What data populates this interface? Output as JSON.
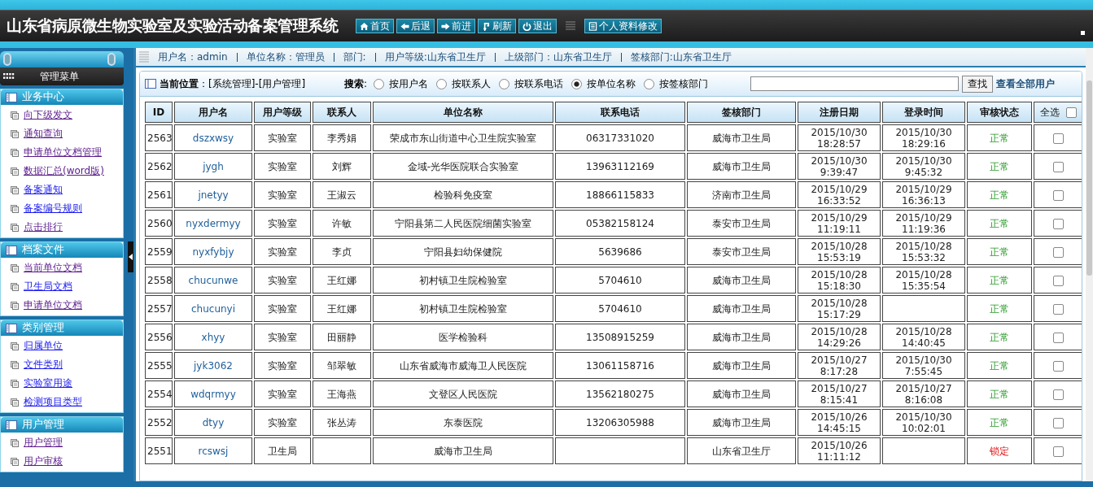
{
  "header": {
    "title": "山东省病原微生物实验室及实验活动备案管理系统",
    "nav_buttons": [
      "首页",
      "后退",
      "前进",
      "刷新",
      "退出"
    ],
    "profile_button": "个人资料修改"
  },
  "info_bar": [
    "用户名：admin",
    "单位名称：管理员",
    "部门:",
    "用户等级:山东省卫生厅",
    "上级部门：山东省卫生厅",
    "签核部门:山东省卫生厅"
  ],
  "sidebar": {
    "title": "管理菜单",
    "sections": [
      {
        "title": "业务中心",
        "items": [
          {
            "label": "向下级发文",
            "visited": true
          },
          {
            "label": "通知查询",
            "visited": true
          },
          {
            "label": "申请单位文档管理",
            "visited": true
          },
          {
            "label": "数据汇总(word版)",
            "visited": true
          },
          {
            "label": "备案通知",
            "visited": false
          },
          {
            "label": "备案编号规则",
            "visited": false
          },
          {
            "label": "点击排行",
            "visited": true
          }
        ]
      },
      {
        "title": "档案文件",
        "items": [
          {
            "label": "当前单位文档",
            "visited": true
          },
          {
            "label": "卫生局文档",
            "visited": false
          },
          {
            "label": "申请单位文档",
            "visited": true
          }
        ]
      },
      {
        "title": "类别管理",
        "items": [
          {
            "label": "归属单位",
            "visited": false
          },
          {
            "label": "文件类别",
            "visited": false
          },
          {
            "label": "实验室用途",
            "visited": false
          },
          {
            "label": "检测项目类型",
            "visited": false
          }
        ]
      },
      {
        "title": "用户管理",
        "items": [
          {
            "label": "用户管理",
            "visited": true
          },
          {
            "label": "用户审核",
            "visited": true
          }
        ]
      }
    ]
  },
  "breadcrumb": {
    "label": "当前位置",
    "path": "：[系统管理]-[用户管理]"
  },
  "search": {
    "label": "**搜索**:",
    "options": [
      {
        "label": "按用户名",
        "selected": false
      },
      {
        "label": "按联系人",
        "selected": false
      },
      {
        "label": "按联系电话",
        "selected": false
      },
      {
        "label": "按单位名称",
        "selected": true
      },
      {
        "label": "按签核部门",
        "selected": false
      }
    ],
    "button": "查找",
    "view_all_link": "查看全部用户"
  },
  "table": {
    "columns": [
      "ID",
      "用户名",
      "用户等级",
      "联系人",
      "单位名称",
      "联系电话",
      "签核部门",
      "注册日期",
      "登录时间",
      "审核状态"
    ],
    "select_all": {
      "label": "全选",
      "checked": false
    },
    "rows": [
      {
        "id": "2563",
        "username": "dszxwsy",
        "level": "实验室",
        "contact": "李秀娟",
        "unit": "荣成市东山街道中心卫生院实验室",
        "phone": "06317331020",
        "dept": "威海市卫生局",
        "registered": [
          "2015/10/30",
          "18:28:57"
        ],
        "login": [
          "2015/10/30",
          "18:29:16"
        ],
        "status": "正常",
        "locked": false,
        "checked": false
      },
      {
        "id": "2562",
        "username": "jygh",
        "level": "实验室",
        "contact": "刘辉",
        "unit": "金域-光华医院联合实验室",
        "phone": "13963112169",
        "dept": "威海市卫生局",
        "registered": [
          "2015/10/30",
          "9:39:47"
        ],
        "login": [
          "2015/10/30",
          "9:45:32"
        ],
        "status": "正常",
        "locked": false,
        "checked": false
      },
      {
        "id": "2561",
        "username": "jnetyy",
        "level": "实验室",
        "contact": "王淑云",
        "unit": "检验科免疫室",
        "phone": "18866115833",
        "dept": "济南市卫生局",
        "registered": [
          "2015/10/29",
          "16:33:52"
        ],
        "login": [
          "2015/10/29",
          "16:36:13"
        ],
        "status": "正常",
        "locked": false,
        "checked": false
      },
      {
        "id": "2560",
        "username": "nyxdermyy",
        "level": "实验室",
        "contact": "许敏",
        "unit": "宁阳县第二人民医院细菌实验室",
        "phone": "05382158124",
        "dept": "泰安市卫生局",
        "registered": [
          "2015/10/29",
          "11:19:11"
        ],
        "login": [
          "2015/10/29",
          "11:19:36"
        ],
        "status": "正常",
        "locked": false,
        "checked": false
      },
      {
        "id": "2559",
        "username": "nyxfybjy",
        "level": "实验室",
        "contact": "李贞",
        "unit": "宁阳县妇幼保健院",
        "phone": "5639686",
        "dept": "泰安市卫生局",
        "registered": [
          "2015/10/28",
          "15:53:19"
        ],
        "login": [
          "2015/10/28",
          "15:53:32"
        ],
        "status": "正常",
        "locked": false,
        "checked": false
      },
      {
        "id": "2558",
        "username": "chucunwe",
        "level": "实验室",
        "contact": "王红娜",
        "unit": "初村镇卫生院检验室",
        "phone": "5704610",
        "dept": "威海市卫生局",
        "registered": [
          "2015/10/28",
          "15:18:30"
        ],
        "login": [
          "2015/10/28",
          "15:35:54"
        ],
        "status": "正常",
        "locked": false,
        "checked": false
      },
      {
        "id": "2557",
        "username": "chucunyi",
        "level": "实验室",
        "contact": "王红娜",
        "unit": "初村镇卫生院检验室",
        "phone": "5704610",
        "dept": "威海市卫生局",
        "registered": [
          "2015/10/28",
          "15:17:29"
        ],
        "login": [],
        "status": "正常",
        "locked": false,
        "checked": false
      },
      {
        "id": "2556",
        "username": "xhyy",
        "level": "实验室",
        "contact": "田丽静",
        "unit": "医学检验科",
        "phone": "13508915259",
        "dept": "威海市卫生局",
        "registered": [
          "2015/10/28",
          "14:29:26"
        ],
        "login": [
          "2015/10/28",
          "14:40:45"
        ],
        "status": "正常",
        "locked": false,
        "checked": false
      },
      {
        "id": "2555",
        "username": "jyk3062",
        "level": "实验室",
        "contact": "邹翠敏",
        "unit": "山东省威海市威海卫人民医院",
        "phone": "13061158716",
        "dept": "威海市卫生局",
        "registered": [
          "2015/10/27",
          "8:17:28"
        ],
        "login": [
          "2015/10/30",
          "7:55:45"
        ],
        "status": "正常",
        "locked": false,
        "checked": false
      },
      {
        "id": "2554",
        "username": "wdqrmyy",
        "level": "实验室",
        "contact": "王海燕",
        "unit": "文登区人民医院",
        "phone": "13562180275",
        "dept": "威海市卫生局",
        "registered": [
          "2015/10/27",
          "8:15:41"
        ],
        "login": [
          "2015/10/27",
          "8:16:08"
        ],
        "status": "正常",
        "locked": false,
        "checked": false
      },
      {
        "id": "2552",
        "username": "dtyy",
        "level": "实验室",
        "contact": "张丛涛",
        "unit": "东泰医院",
        "phone": "13206305988",
        "dept": "威海市卫生局",
        "registered": [
          "2015/10/26",
          "14:45:15"
        ],
        "login": [
          "2015/10/30",
          "10:02:01"
        ],
        "status": "正常",
        "locked": false,
        "checked": false
      },
      {
        "id": "2551",
        "username": "rcswsj",
        "level": "卫生局",
        "contact": "",
        "unit": "威海市卫生局",
        "phone": "",
        "dept": "山东省卫生厅",
        "registered": [
          "2015/10/26",
          "11:11:12"
        ],
        "login": [],
        "status": "锁定",
        "locked": true,
        "checked": false
      }
    ]
  }
}
